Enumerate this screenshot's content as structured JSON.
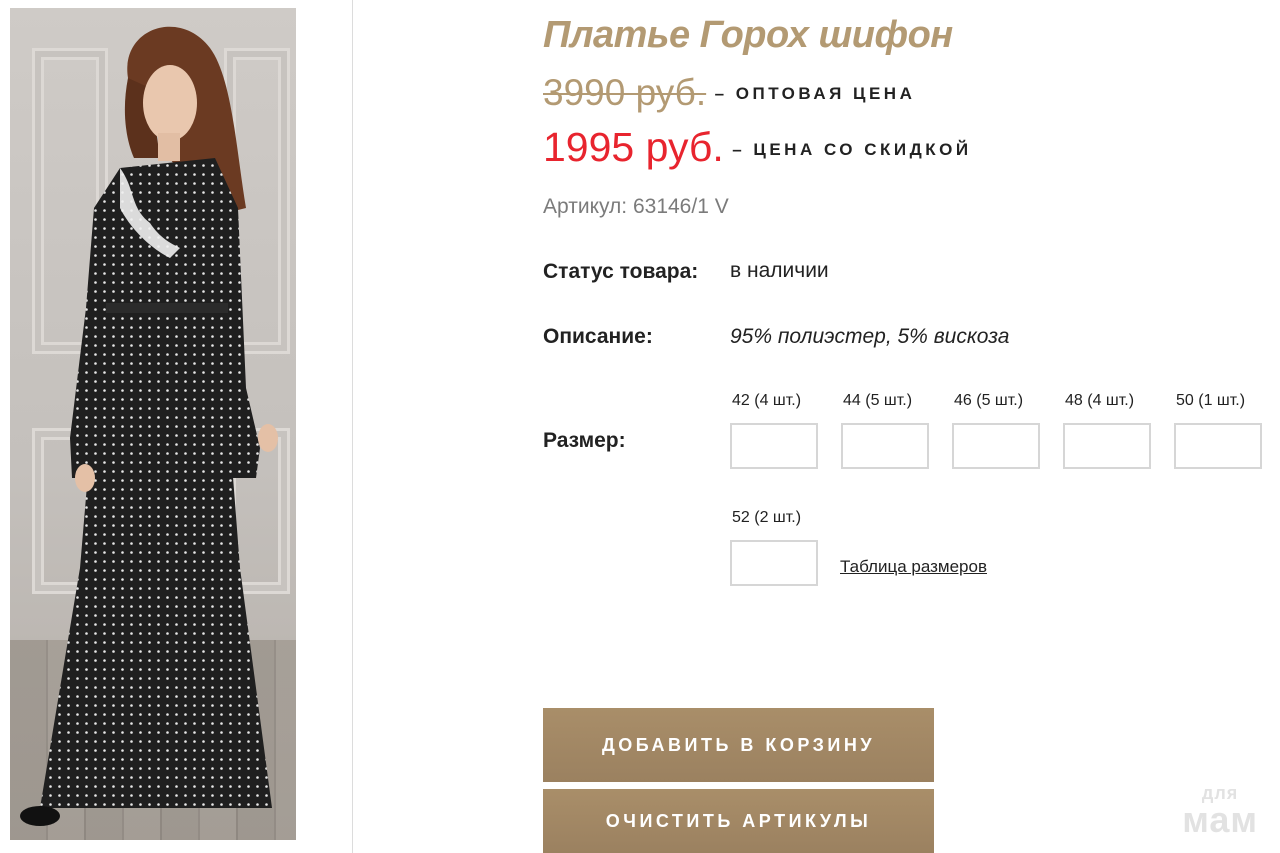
{
  "product": {
    "title": "Платье Горох шифон",
    "old_price": "3990 руб.",
    "old_price_note": "– ОПТОВАЯ ЦЕНА",
    "new_price": "1995 руб.",
    "new_price_note": "– ЦЕНА СО СКИДКОЙ",
    "sku": "Артикул: 63146/1 V"
  },
  "details": {
    "status_label": "Статус товара:",
    "status_value": "в наличии",
    "description_label": "Описание:",
    "description_value": "95% полиэстер, 5% вискоза",
    "size_label": "Размер:"
  },
  "sizes": [
    {
      "label": "42 (4 шт.)",
      "value": ""
    },
    {
      "label": "44 (5 шт.)",
      "value": ""
    },
    {
      "label": "46 (5 шт.)",
      "value": ""
    },
    {
      "label": "48 (4 шт.)",
      "value": ""
    },
    {
      "label": "50 (1 шт.)",
      "value": ""
    },
    {
      "label": "52 (2 шт.)",
      "value": ""
    }
  ],
  "size_table_link": "Таблица размеров",
  "buttons": {
    "add_to_cart": "ДОБАВИТЬ В КОРЗИНУ",
    "clear": "ОЧИСТИТЬ АРТИКУЛЫ"
  },
  "watermark": {
    "top": "для",
    "bottom": "мам"
  },
  "colors": {
    "accent": "#b39a73",
    "sale": "#e8242e",
    "button": "#a38863"
  }
}
